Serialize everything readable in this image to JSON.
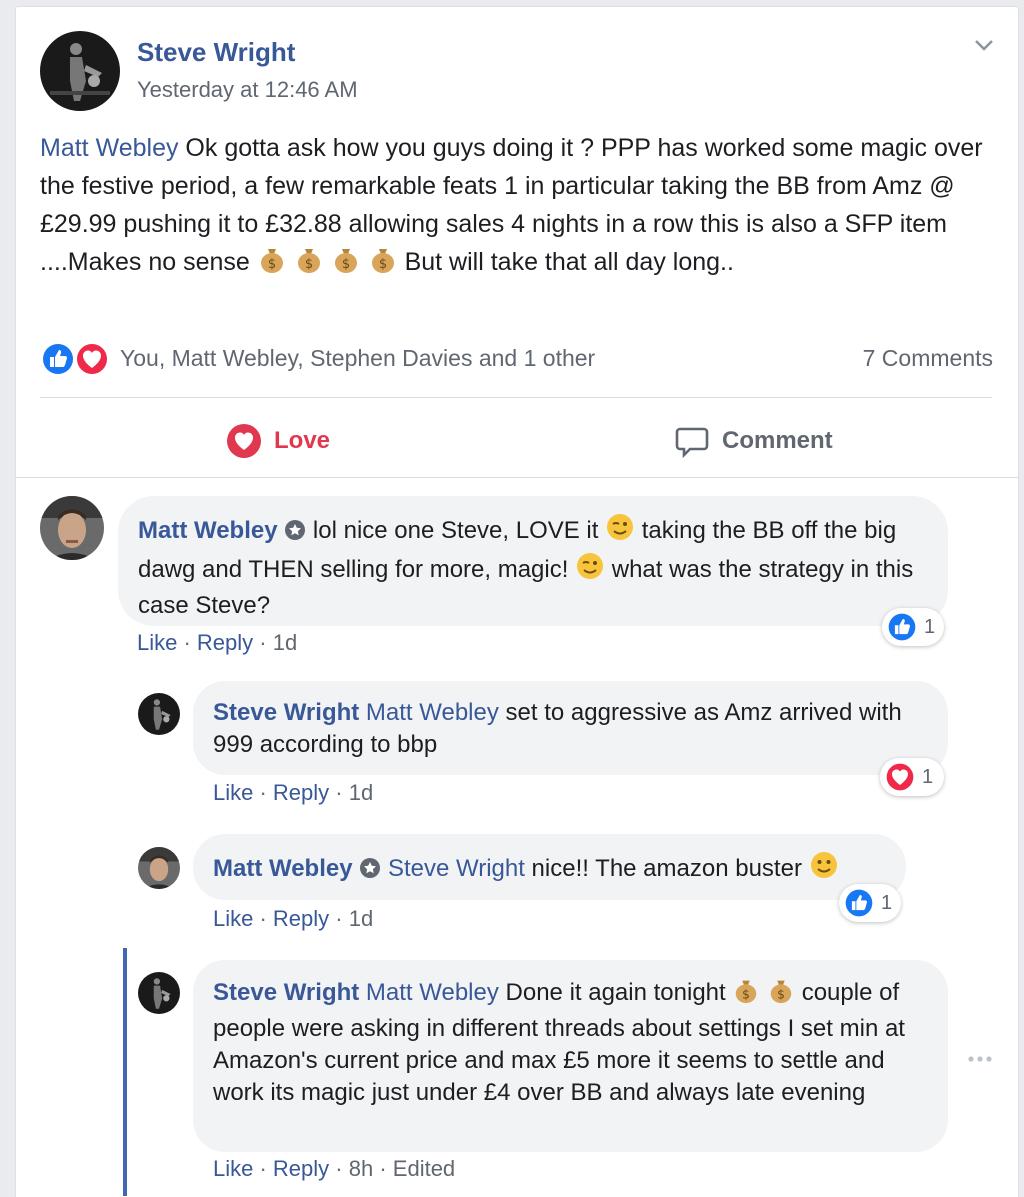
{
  "post": {
    "author": "Steve Wright",
    "timestamp": "Yesterday at 12:46 AM",
    "mention": "Matt Webley",
    "text_1": " Ok gotta ask how you guys doing it ? PPP has worked some magic over the festive period, a few remarkable feats 1 in particular taking the BB from Amz @ £29.99 pushing it to £32.88 allowing sales 4 nights in a row this is also a SFP item ....Makes no sense ",
    "text_2": " But will take that all day long..",
    "reactions_summary": "You, Matt Webley, Stephen Davies and 1 other",
    "comments_count": "7 Comments",
    "love_label": "Love",
    "comment_label": "Comment"
  },
  "comments": [
    {
      "author": "Matt Webley",
      "text_1": " lol nice one Steve, LOVE it ",
      "text_2": " taking the BB off the big dawg and THEN selling for more, magic! ",
      "text_3": " what was the strategy in this case Steve?",
      "like": "Like",
      "reply": "Reply",
      "age": "1d",
      "reaction_count": "1"
    },
    {
      "author": "Steve Wright",
      "mention": "Matt Webley",
      "text": " set to aggressive as Amz arrived with 999 according to bbp",
      "like": "Like",
      "reply": "Reply",
      "age": "1d",
      "reaction_count": "1"
    },
    {
      "author": "Matt Webley",
      "mention": "Steve Wright",
      "text": " nice!! The amazon buster ",
      "like": "Like",
      "reply": "Reply",
      "age": "1d",
      "reaction_count": "1"
    },
    {
      "author": "Steve Wright",
      "mention": "Matt Webley",
      "text_1": " Done it again tonight ",
      "text_2": " couple of people were asking in different threads about settings I set min at Amazon's current price and max £5 more it seems to settle and work its magic just under £4 over BB and always late evening",
      "like": "Like",
      "reply": "Reply",
      "age": "8h",
      "edited": "Edited"
    }
  ],
  "colors": {
    "name_blue": "#385898",
    "love_red": "#e0394f",
    "like_blue": "#1877f2",
    "thread_line": "#4267b2"
  },
  "icons": [
    "chevron-down-icon",
    "like-reaction-icon",
    "love-reaction-icon",
    "heart-icon",
    "comment-icon",
    "money-bag-emoji",
    "wink-emoji",
    "smile-emoji",
    "shield-badge-icon",
    "more-options-icon"
  ]
}
